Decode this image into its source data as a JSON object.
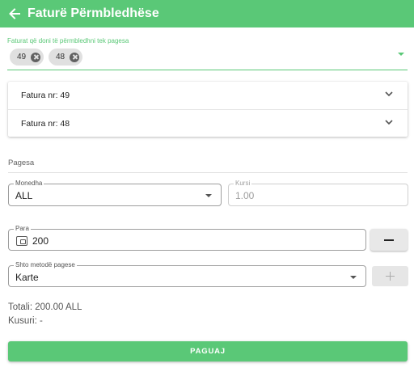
{
  "appbar": {
    "title": "Faturë Përmbledhëse",
    "back_icon": "arrow-left-icon"
  },
  "invoice_select": {
    "label": "Faturat që doni të përmbledhni tek pagesa",
    "chips": [
      "49",
      "48"
    ]
  },
  "invoices": [
    {
      "label": "Fatura nr: 49"
    },
    {
      "label": "Fatura nr: 48"
    }
  ],
  "payment": {
    "section_title": "Pagesa",
    "currency": {
      "label": "Monedha",
      "value": "ALL"
    },
    "rate": {
      "label": "Kursi",
      "value": "1.00"
    },
    "money": {
      "label": "Para",
      "value": "200"
    },
    "method": {
      "label": "Shto metodë pagese",
      "value": "Karte"
    },
    "total": "Totali: 200.00 ALL",
    "change": "Kusuri: -",
    "pay_button": "PAGUAJ"
  },
  "colors": {
    "accent": "#5ac877",
    "chip_bg": "#e0e0e0"
  }
}
